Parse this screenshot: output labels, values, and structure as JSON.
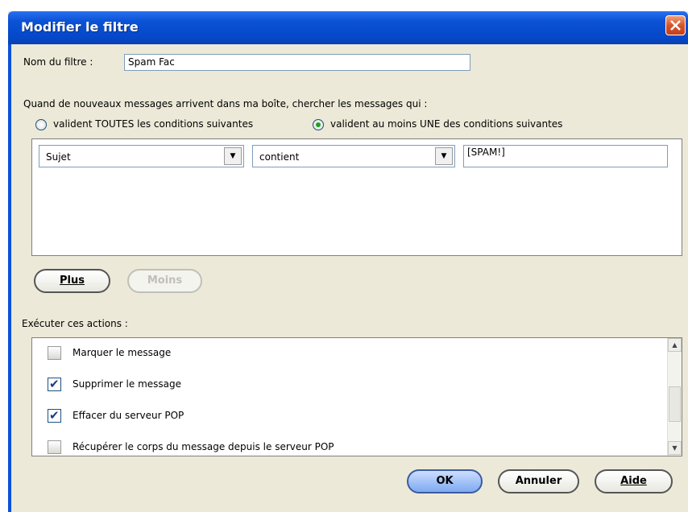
{
  "dialog": {
    "title": "Modifier le filtre"
  },
  "filter_name": {
    "label": "Nom du filtre :",
    "value": "Spam Fac"
  },
  "match": {
    "prompt": "Quand de nouveaux messages arrivent dans ma boîte, chercher les messages qui :",
    "option_all": "valident TOUTES les conditions suivantes",
    "option_any": "valident au moins UNE des conditions suivantes",
    "selected": "any"
  },
  "condition": {
    "field": "Sujet",
    "operator": "contient",
    "value": "[SPAM!]"
  },
  "buttons": {
    "plus": "Plus",
    "moins": "Moins",
    "ok": "OK",
    "cancel": "Annuler",
    "help": "Aide"
  },
  "actions": {
    "label": "Exécuter ces actions :",
    "items": [
      {
        "label": "Marquer le message",
        "checked": false
      },
      {
        "label": "Supprimer le message",
        "checked": true
      },
      {
        "label": "Effacer du serveur POP",
        "checked": true
      },
      {
        "label": "Récupérer le corps du message depuis le serveur POP",
        "checked": false
      }
    ]
  },
  "icons": {
    "close": "close-icon",
    "dropdown": "chevron-down-icon",
    "check": "checkmark-icon"
  }
}
